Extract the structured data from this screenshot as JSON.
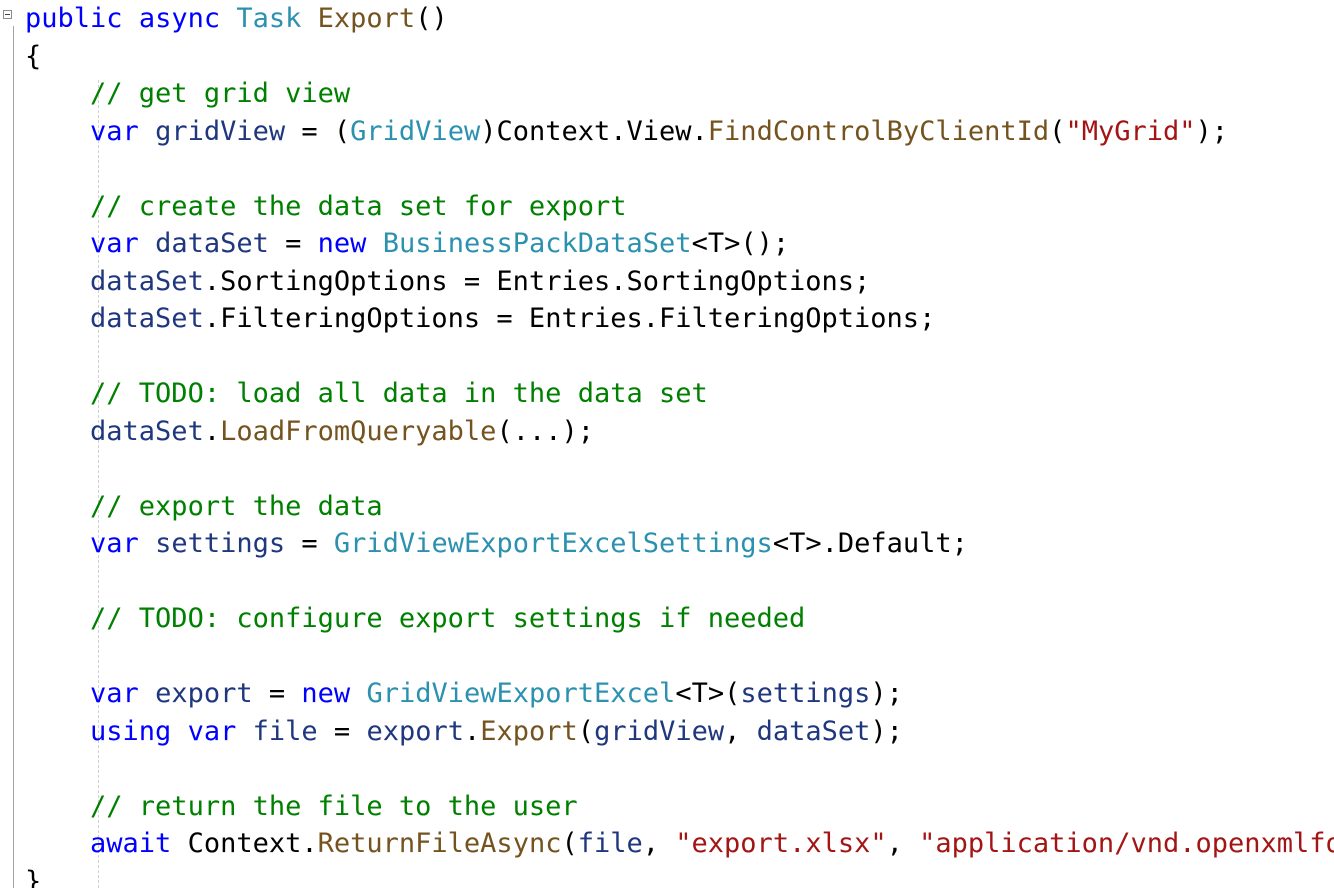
{
  "editor": {
    "signature": {
      "kw_public": "public",
      "kw_async": "async",
      "type_task": "Task",
      "method_name": "Export",
      "parens": "()"
    },
    "open_brace": "{",
    "close_brace": "}",
    "comments": {
      "get_grid": "// get grid view",
      "create_data_set": "// create the data set for export",
      "todo_load": "// TODO: load all data in the data set",
      "export_data": "// export the data",
      "todo_configure": "// TODO: configure export settings if needed",
      "return_file": "// return the file to the user"
    },
    "grid_line": {
      "kw_var": "var",
      "var_name": "gridView",
      "eq": " = (",
      "cast_type": "GridView",
      "close_paren": ")",
      "context": "Context.View.",
      "find_method": "FindControlByClientId",
      "open": "(",
      "grid_id": "\"MyGrid\"",
      "end": ");"
    },
    "dataset_line": {
      "kw_var": "var",
      "var_name": "dataSet",
      "eq": " = ",
      "kw_new": "new",
      "type": "BusinessPackDataSet",
      "generic": "<T>();"
    },
    "sorting_line": {
      "var_name": "dataSet",
      "rest": ".SortingOptions = Entries.SortingOptions;"
    },
    "filtering_line": {
      "var_name": "dataSet",
      "rest": ".FilteringOptions = Entries.FilteringOptions;"
    },
    "load_line": {
      "var_name": "dataSet",
      "dot": ".",
      "method": "LoadFromQueryable",
      "args": "(...);"
    },
    "settings_line": {
      "kw_var": "var",
      "var_name": "settings",
      "eq": " = ",
      "type": "GridViewExportExcelSettings",
      "rest": "<T>.Default;"
    },
    "export_line": {
      "kw_var": "var",
      "var_name": "export",
      "eq": " = ",
      "kw_new": "new",
      "type": "GridViewExportExcel",
      "generic_open": "<T>(",
      "arg": "settings",
      "end": ");"
    },
    "using_line": {
      "kw_using": "using",
      "kw_var": "var",
      "var_name": "file",
      "eq": " = ",
      "obj": "export",
      "dot": ".",
      "method": "Export",
      "open": "(",
      "arg1": "gridView",
      "comma": ", ",
      "arg2": "dataSet",
      "end": ");"
    },
    "return_line": {
      "kw_await": "await",
      "context": "Context.",
      "method": "ReturnFileAsync",
      "open": "(",
      "arg": "file",
      "comma1": ", ",
      "filename": "\"export.xlsx\"",
      "comma2": ", ",
      "mime": "\"application/vnd.openxmlformats-officedocument.spreadsheetml.sheet\""
    }
  }
}
